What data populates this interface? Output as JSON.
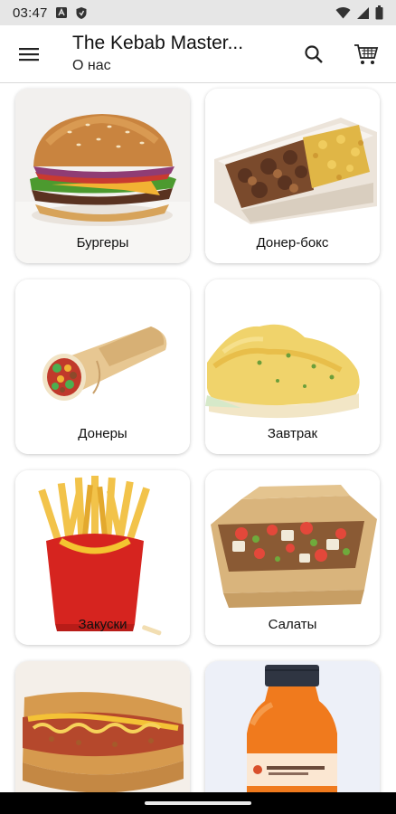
{
  "status_bar": {
    "time": "03:47",
    "icons": [
      "text-notification-icon",
      "shield-icon",
      "wifi-icon",
      "signal-icon",
      "battery-icon"
    ]
  },
  "app_bar": {
    "title": "The Kebab Master...",
    "subtitle": "О нас",
    "icons": [
      "menu-icon",
      "search-icon",
      "cart-icon"
    ]
  },
  "categories": [
    {
      "label": "Бургеры"
    },
    {
      "label": "Донер-бокс"
    },
    {
      "label": "Донеры"
    },
    {
      "label": "Завтрак"
    },
    {
      "label": "Закуски"
    },
    {
      "label": "Салаты"
    },
    {
      "label": ""
    },
    {
      "label": ""
    }
  ],
  "colors": {
    "status_bar_bg": "#e6e6e6",
    "app_bar_bg": "#ffffff",
    "nav_bar_bg": "#000000"
  }
}
